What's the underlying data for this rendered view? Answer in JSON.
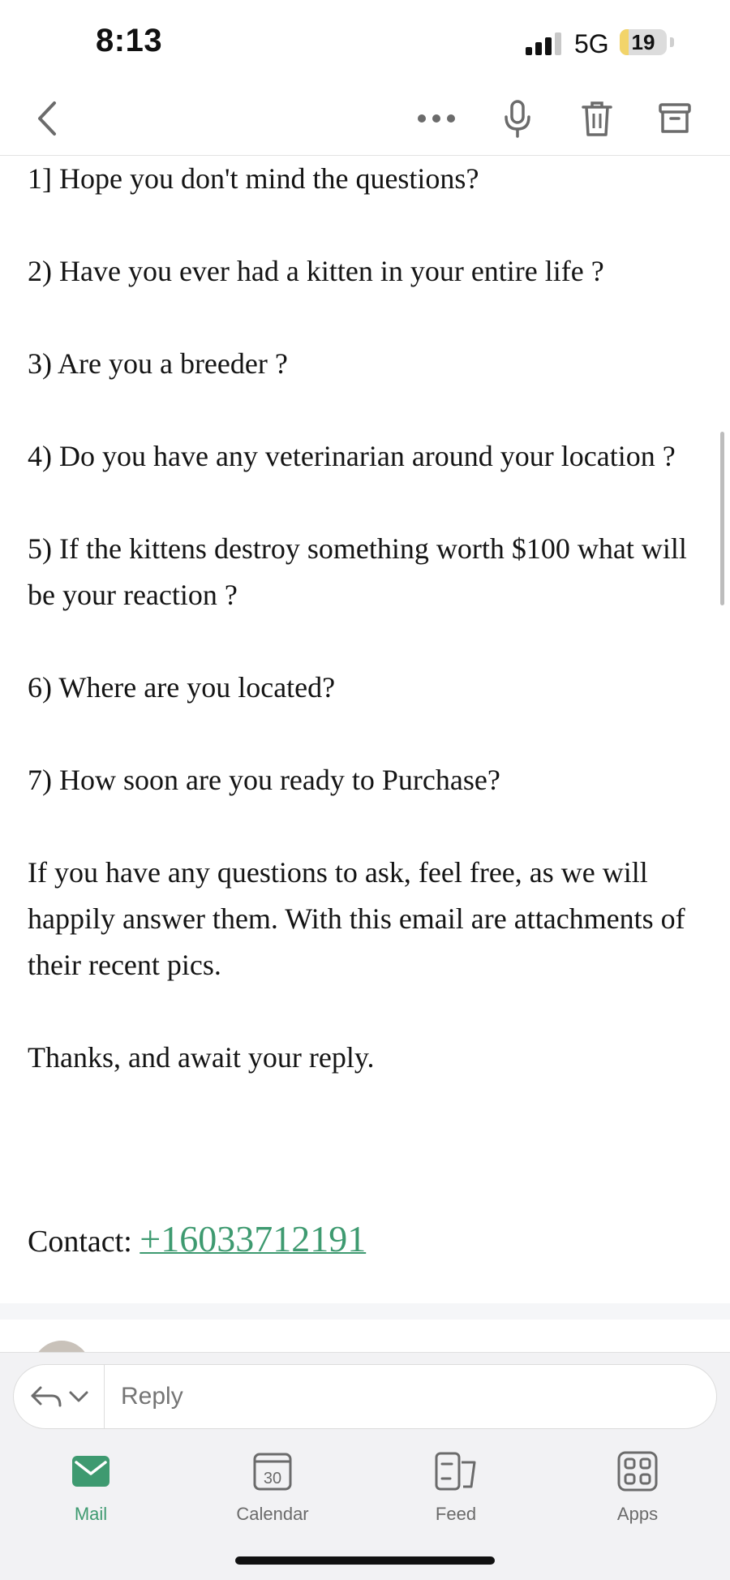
{
  "status_bar": {
    "time": "8:13",
    "network": "5G",
    "battery": "19",
    "battery_level_percent": 19
  },
  "toolbar": {
    "icons": [
      "back-chevron-icon",
      "more-icon",
      "microphone-icon",
      "trash-icon",
      "archive-icon"
    ]
  },
  "email": {
    "lines": [
      "1] Hope you don't mind the questions?",
      "2) Have you ever had a kitten in your entire life ?",
      "3) Are you a breeder ?",
      "4) Do you have any veterinarian around your location ?",
      "5) If the kittens destroy something worth $100 what will be your reaction ?",
      "6) Where are you located?",
      "7) How soon are you ready to Purchase?",
      "If you have any questions to ask, feel free, as we will happily answer them. With this email are attachments of their recent pics.",
      "Thanks, and await your reply."
    ],
    "contact_label": "Contact:",
    "contact_phone": "+16033712191"
  },
  "reply": {
    "placeholder": "Reply"
  },
  "tabs": [
    {
      "label": "Mail",
      "icon": "mail-icon",
      "active": true
    },
    {
      "label": "Calendar",
      "icon": "calendar-icon",
      "calendar_day": "30",
      "active": false
    },
    {
      "label": "Feed",
      "icon": "feed-icon",
      "active": false
    },
    {
      "label": "Apps",
      "icon": "apps-icon",
      "active": false
    }
  ],
  "colors": {
    "accent": "#3e9a70",
    "battery_fill": "#f2d46a"
  }
}
